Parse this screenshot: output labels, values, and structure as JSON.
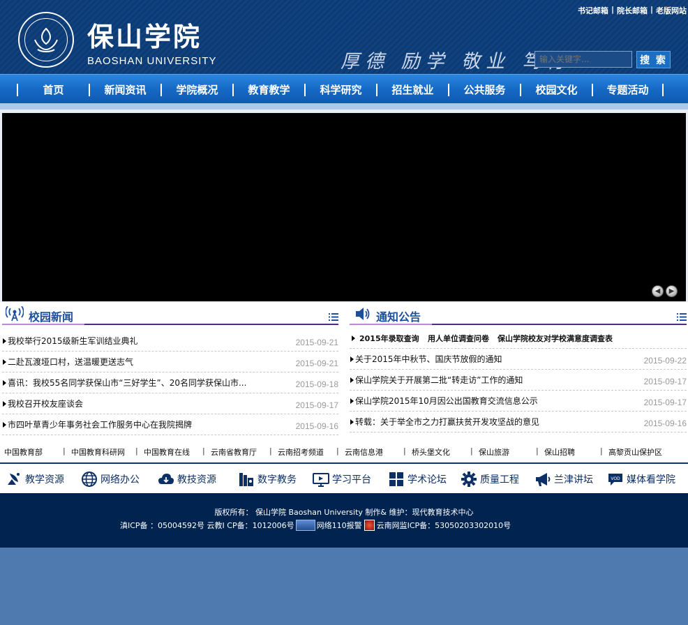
{
  "header": {
    "logo_cn": "保山学院",
    "logo_en": "BAOSHAN UNIVERSITY",
    "motto": "厚德 励学 敬业 笃行",
    "top_links": [
      "书记邮箱",
      "院长邮箱",
      "老版网站"
    ],
    "search_placeholder": "输入关键字...",
    "search_button": "搜 索"
  },
  "nav": [
    "首页",
    "新闻资讯",
    "学院概况",
    "教育教学",
    "科学研究",
    "招生就业",
    "公共服务",
    "校园文化",
    "专题活动"
  ],
  "campus_news": {
    "title": "校园新闻",
    "items": [
      {
        "text": "我校举行2015级新生军训结业典礼",
        "date": "2015-09-21"
      },
      {
        "text": "二赴瓦渡垭口村，送温暖更送志气",
        "date": "2015-09-21"
      },
      {
        "text": "喜讯：我校55名同学获保山市“三好学生”、20名同学获保山市...",
        "date": "2015-09-18"
      },
      {
        "text": "我校召开校友座谈会",
        "date": "2015-09-17"
      },
      {
        "text": "市四叶草青少年事务社会工作服务中心在我院揭牌",
        "date": "2015-09-16"
      }
    ]
  },
  "notices": {
    "title": "通知公告",
    "quick_links": [
      "2015年录取查询",
      "用人单位调查问卷",
      "保山学院校友对学校满意度调查表"
    ],
    "items": [
      {
        "text": "关于2015年中秋节、国庆节放假的通知",
        "date": "2015-09-22"
      },
      {
        "text": "保山学院关于开展第二批“转走访”工作的通知",
        "date": "2015-09-17"
      },
      {
        "text": "保山学院2015年10月因公出国教育交流信息公示",
        "date": "2015-09-17"
      },
      {
        "text": "转载：关于举全市之力打赢扶贫开发攻坚战的意见",
        "date": "2015-09-16"
      }
    ]
  },
  "friend_links": [
    "中国教育部",
    "中国教育科研网",
    "中国教育在线",
    "云南省教育厅",
    "云南招考频道",
    "云南信息港",
    "桥头堡文化",
    "保山旅游",
    "保山招聘",
    "高黎贡山保护区"
  ],
  "icon_bar": [
    {
      "label": "教学资源",
      "icon": "satellite-dish-icon"
    },
    {
      "label": "网络办公",
      "icon": "globe-icon"
    },
    {
      "label": "教技资源",
      "icon": "cloud-icon"
    },
    {
      "label": "数字教务",
      "icon": "books-icon"
    },
    {
      "label": "学习平台",
      "icon": "monitor-icon"
    },
    {
      "label": "学术论坛",
      "icon": "grid-icon"
    },
    {
      "label": "质量工程",
      "icon": "gear-icon"
    },
    {
      "label": "兰津讲坛",
      "icon": "megaphone-icon"
    },
    {
      "label": "媒体看学院",
      "icon": "chat-icon"
    }
  ],
  "footer": {
    "copyright": "版权所有：  保山学院 Baoshan University  制作& 维护：现代教育技术中心",
    "icp": "滇ICP备  ：05004592号 云教I  CP备：1012006号",
    "report": "网络110报警",
    "police": "云南网监ICP备：53050203302010号"
  },
  "colors": {
    "header_bg": "#0d3a73",
    "nav_bg": "#1669c4",
    "footer_bg": "#00244f",
    "page_bg": "#4e7ab0",
    "title_blue": "#1c4f9c",
    "divider_purple": "#4a2c82"
  }
}
